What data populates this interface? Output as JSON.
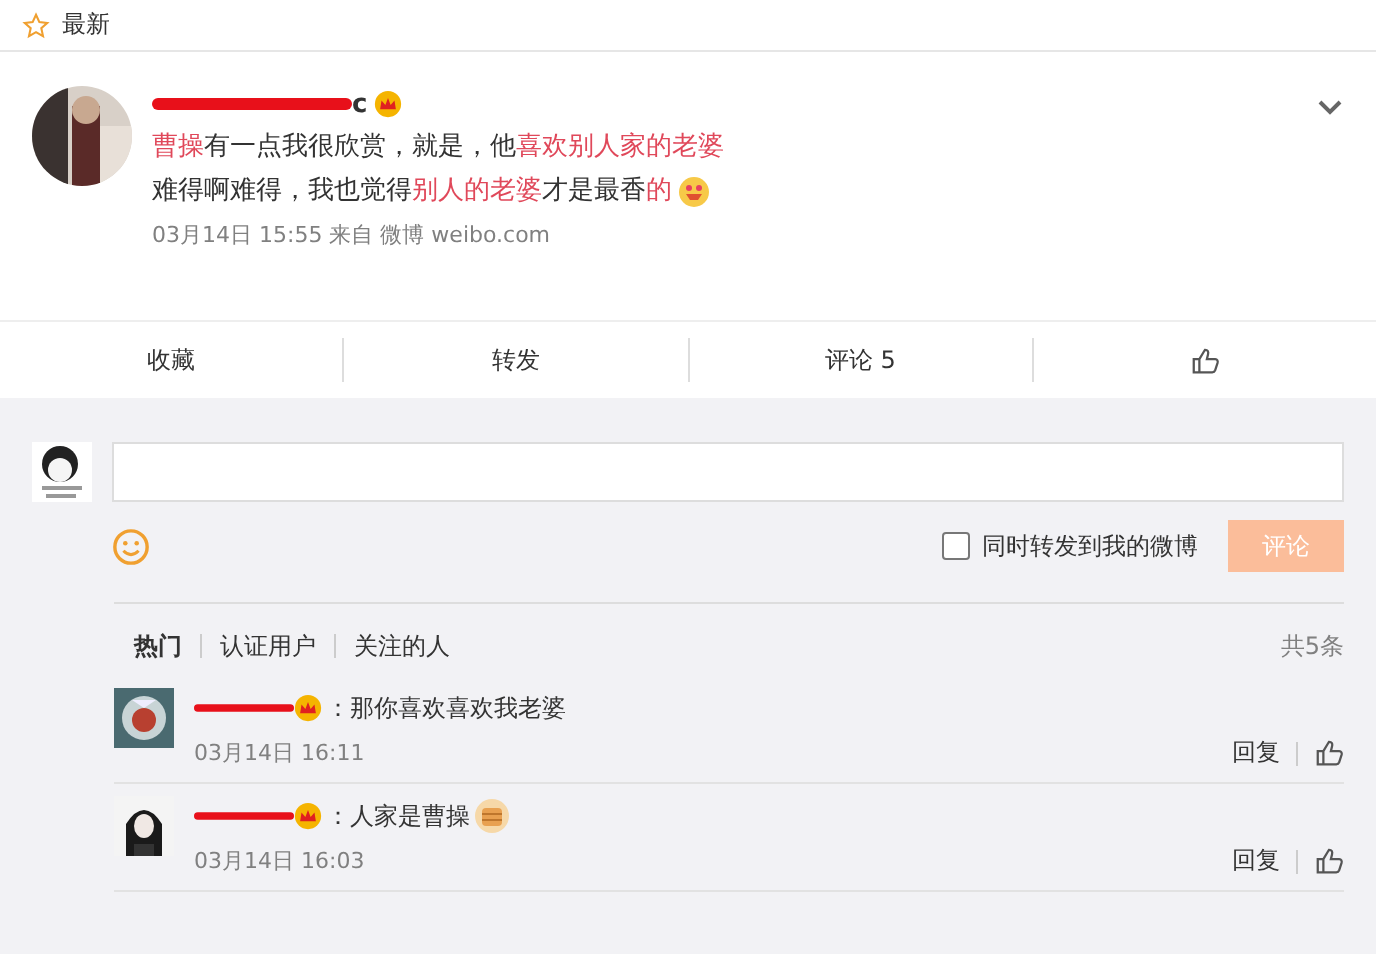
{
  "header": {
    "label": "最新"
  },
  "post": {
    "name_visible": "c",
    "lines": [
      [
        {
          "text": "曹操",
          "highlight": true
        },
        {
          "text": "有一点我很欣赏，就是，他",
          "highlight": false
        },
        {
          "text": "喜欢别人家的老婆",
          "highlight": true
        }
      ],
      [
        {
          "text": "难得啊难得，我也觉得",
          "highlight": false
        },
        {
          "text": "别人的老婆",
          "highlight": true
        },
        {
          "text": "才是最香",
          "highlight": false
        },
        {
          "text": "的",
          "highlight": true
        }
      ]
    ],
    "meta": "03月14日 15:55  来自 微博 weibo.com"
  },
  "actions": [
    {
      "kind": "text",
      "label": "收藏"
    },
    {
      "kind": "text",
      "label": "转发"
    },
    {
      "kind": "text",
      "label": "评论 5"
    },
    {
      "kind": "like"
    }
  ],
  "composer": {
    "repost_label": "同时转发到我的微博",
    "repost_checked": false,
    "submit": "评论"
  },
  "filters": [
    {
      "label": "热门",
      "selected": true
    },
    {
      "label": "认证用户",
      "selected": false
    },
    {
      "label": "关注的人",
      "selected": false
    }
  ],
  "total": "共5条",
  "comments": [
    {
      "text": "：那你喜欢喜欢我老婆",
      "emoji": false,
      "time": "03月14日 16:11",
      "reply": "回复"
    },
    {
      "text": "：人家是曹操",
      "emoji": true,
      "time": "03月14日 16:03",
      "reply": "回复"
    }
  ]
}
